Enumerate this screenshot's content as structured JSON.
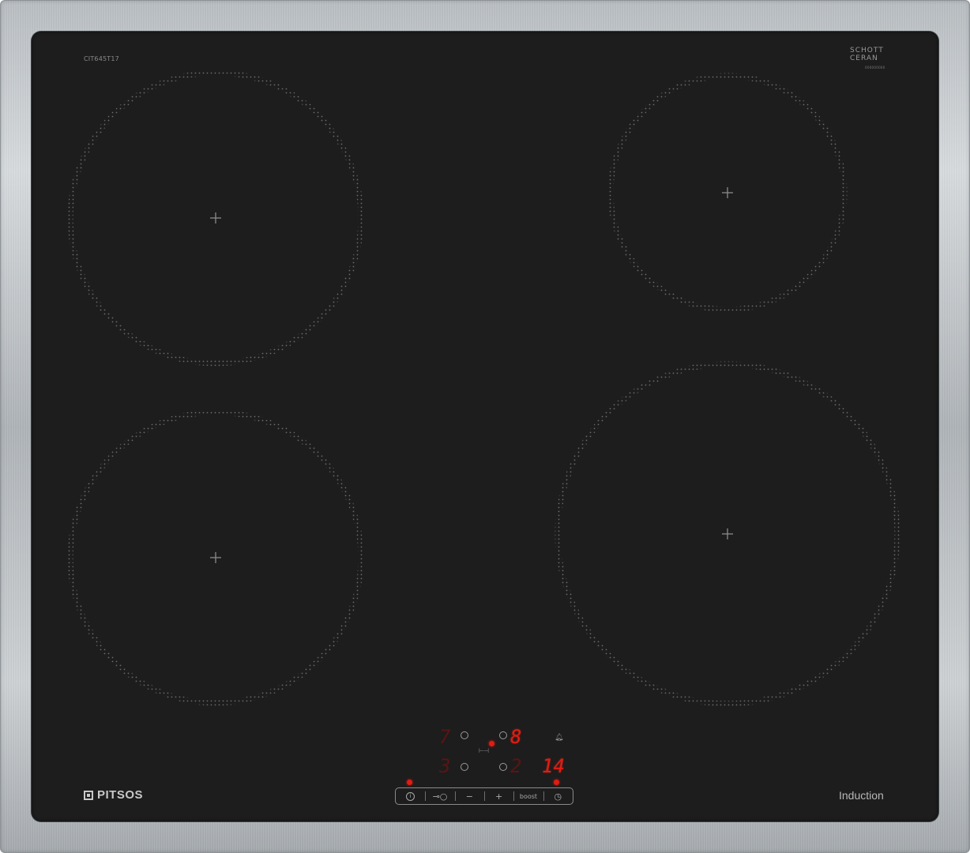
{
  "hob": {
    "model_code": "CIT645T17",
    "glass_brand_line1": "SCHOTT",
    "glass_brand_line2": "CERAN",
    "glass_serial": "000000000",
    "brand_name": "PITSOS",
    "type_label": "Induction"
  },
  "displays": {
    "rear_left_level": "7",
    "rear_right_level": "8",
    "front_left_level": "3",
    "front_right_level": "2",
    "timer_value": "14"
  },
  "controls": {
    "power_symbol": "i",
    "lock_symbol": "⊸○",
    "minus_symbol": "−",
    "plus_symbol": "+",
    "boost_label": "boost",
    "timer_symbol": "◷"
  },
  "icons": {
    "bell": "bell-icon",
    "bridge": "bridge-icon"
  },
  "colors": {
    "glass": "#1d1d1d",
    "led_red": "#e21c12",
    "frame_steel": "#b8bdc1"
  }
}
